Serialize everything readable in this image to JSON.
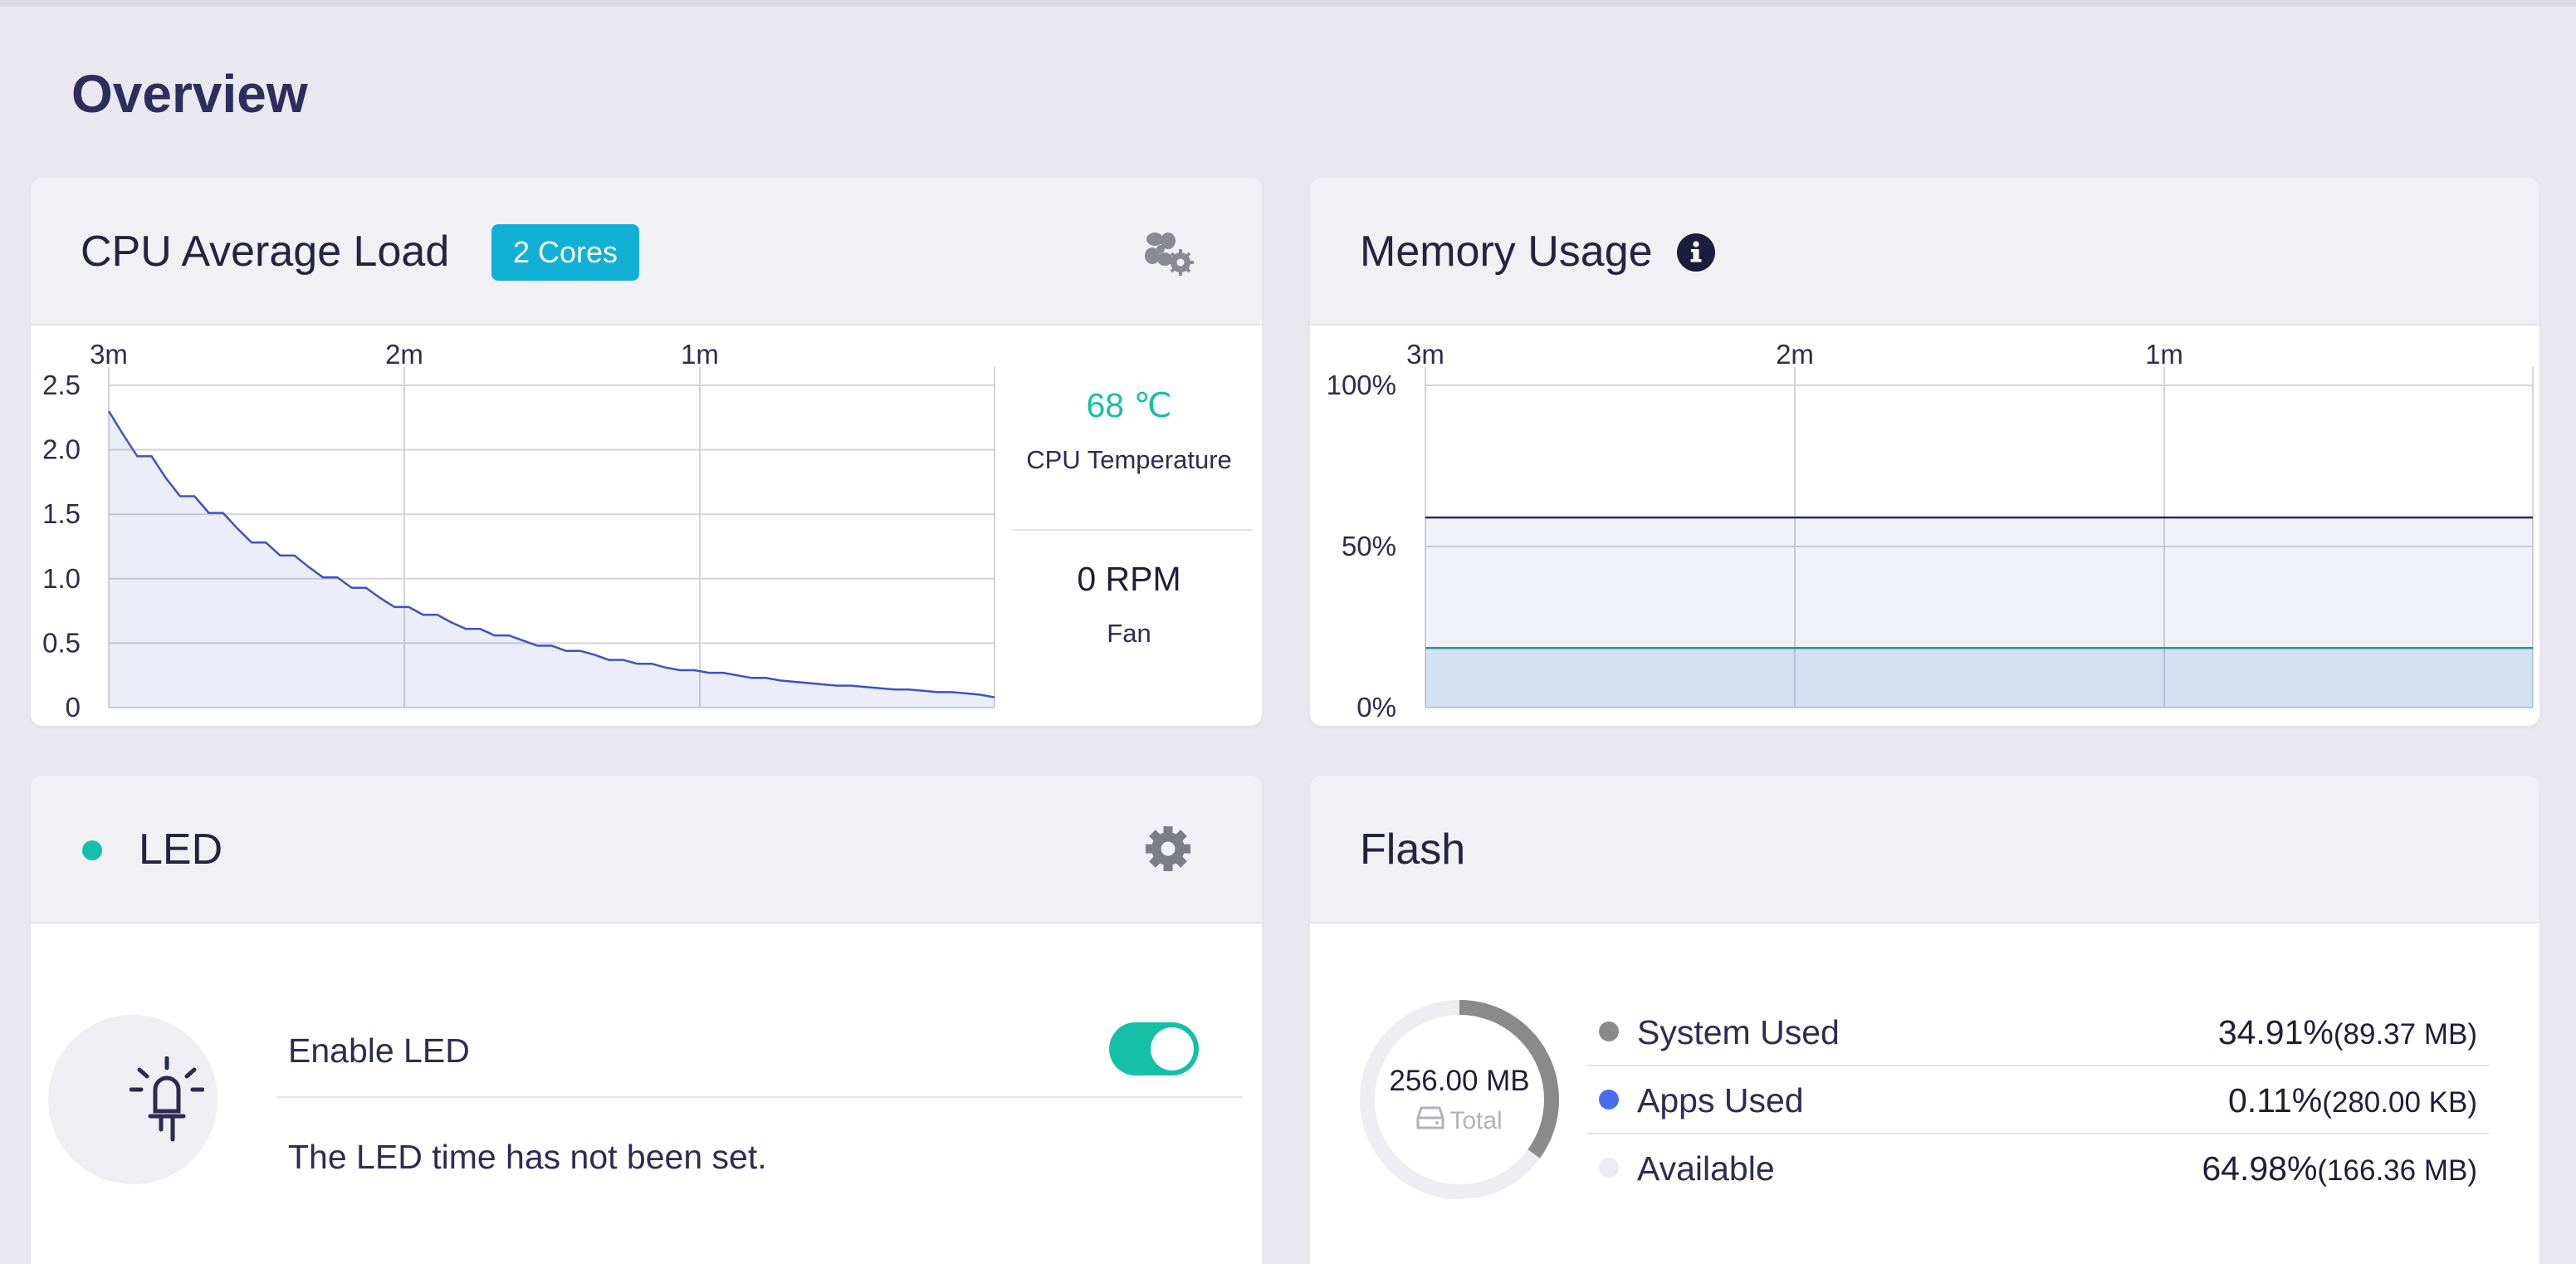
{
  "page": {
    "title": "Overview"
  },
  "cpu": {
    "title": "CPU Average Load",
    "badge": "2 Cores",
    "temperature": "68 ℃",
    "temperature_label": "CPU Temperature",
    "fan_value": "0 RPM",
    "fan_label": "Fan"
  },
  "memory": {
    "title": "Memory Usage"
  },
  "led": {
    "title": "LED",
    "enable_label": "Enable LED",
    "enabled": true,
    "message": "The LED time has not been set."
  },
  "flash": {
    "title": "Flash",
    "total_value": "256.00 MB",
    "total_label": "Total",
    "used_fraction": 0.3502,
    "rows": [
      {
        "label": "System Used",
        "percent": "34.91%",
        "size": "(89.37 MB)",
        "color": "#8a8a8a"
      },
      {
        "label": "Apps Used",
        "percent": "0.11%",
        "size": "(280.00 KB)",
        "color": "#4a6cf0"
      },
      {
        "label": "Available",
        "percent": "64.98%",
        "size": "(166.36 MB)",
        "color": "#ecebf1"
      }
    ]
  },
  "colors": {
    "accent_teal": "#14c0a6",
    "badge_blue": "#12b0d4",
    "cpu_line": "#3f51c8",
    "memory_line": "#2a2a5a",
    "memory_line2": "#1a9a9a"
  },
  "chart_data": [
    {
      "type": "area",
      "title": "CPU Average Load",
      "x_ticks": [
        "3m",
        "2m",
        "1m"
      ],
      "y_ticks": [
        "2.5",
        "2.0",
        "1.5",
        "1.0",
        "0.5",
        "0"
      ],
      "ylim": [
        0,
        2.5
      ],
      "grid": true,
      "series": [
        {
          "values": [
            2.3,
            2.12,
            1.95,
            1.95,
            1.78,
            1.64,
            1.64,
            1.51,
            1.51,
            1.39,
            1.28,
            1.28,
            1.18,
            1.18,
            1.09,
            1.01,
            1.01,
            0.93,
            0.93,
            0.85,
            0.78,
            0.78,
            0.72,
            0.72,
            0.66,
            0.61,
            0.61,
            0.56,
            0.56,
            0.52,
            0.48,
            0.48,
            0.44,
            0.44,
            0.41,
            0.37,
            0.37,
            0.34,
            0.34,
            0.31,
            0.29,
            0.29,
            0.27,
            0.27,
            0.25,
            0.23,
            0.23,
            0.21,
            0.2,
            0.19,
            0.18,
            0.17,
            0.17,
            0.16,
            0.15,
            0.14,
            0.14,
            0.13,
            0.12,
            0.12,
            0.11,
            0.1,
            0.08
          ]
        }
      ]
    },
    {
      "type": "area",
      "title": "Memory Usage",
      "x_ticks": [
        "3m",
        "2m",
        "1m"
      ],
      "y_ticks": [
        "100%",
        "50%",
        "0%"
      ],
      "ylim": [
        0,
        100
      ],
      "grid": true,
      "series": [
        {
          "values": [
            59,
            59,
            59,
            59,
            59,
            59,
            59,
            59,
            59,
            59,
            59,
            59,
            59
          ]
        },
        {
          "values": [
            18.5,
            18.5,
            18.5,
            18.5,
            18.5,
            18.5,
            18.5,
            18.5,
            18.5,
            18.5,
            18.5,
            18.5,
            18.5
          ]
        }
      ]
    }
  ]
}
